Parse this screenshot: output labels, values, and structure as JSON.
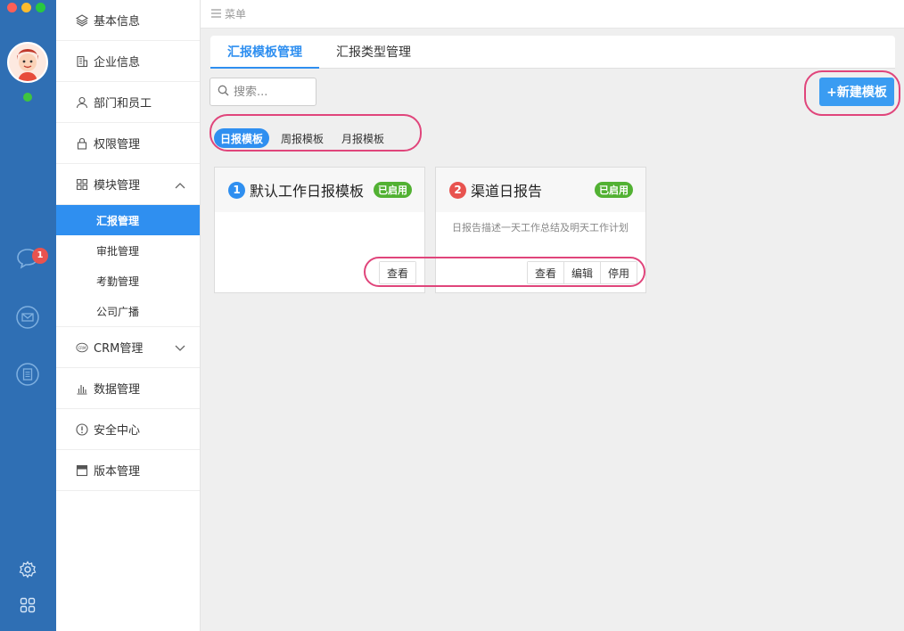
{
  "menu_bar": {
    "label": "菜单"
  },
  "sidebar": {
    "items": [
      {
        "label": "基本信息",
        "icon": "layers-icon"
      },
      {
        "label": "企业信息",
        "icon": "building-icon"
      },
      {
        "label": "部门和员工",
        "icon": "user-icon"
      },
      {
        "label": "权限管理",
        "icon": "lock-icon"
      },
      {
        "label": "模块管理",
        "icon": "grid-icon",
        "expanded": true,
        "children": [
          {
            "label": "汇报管理",
            "active": true
          },
          {
            "label": "审批管理"
          },
          {
            "label": "考勤管理"
          },
          {
            "label": "公司广播"
          }
        ]
      },
      {
        "label": "CRM管理",
        "icon": "crm-icon"
      },
      {
        "label": "数据管理",
        "icon": "bar-chart-icon"
      },
      {
        "label": "安全中心",
        "icon": "alert-icon"
      },
      {
        "label": "版本管理",
        "icon": "card-icon"
      }
    ]
  },
  "rail": {
    "chat_badge": "1"
  },
  "tabs": [
    {
      "label": "汇报模板管理",
      "active": true
    },
    {
      "label": "汇报类型管理",
      "active": false
    }
  ],
  "search": {
    "placeholder": "搜索..."
  },
  "new_button": {
    "label": "+新建模板"
  },
  "subtabs": [
    {
      "label": "日报模板",
      "active": true
    },
    {
      "label": "周报模板",
      "active": false
    },
    {
      "label": "月报模板",
      "active": false
    }
  ],
  "cards": [
    {
      "number": "1",
      "number_color": "#2f8ff0",
      "title": "默认工作日报模板",
      "status": "已启用",
      "description": "",
      "actions": [
        "查看"
      ]
    },
    {
      "number": "2",
      "number_color": "#e8534f",
      "title": "渠道日报告",
      "status": "已启用",
      "description": "日报告描述一天工作总结及明天工作计划",
      "actions": [
        "查看",
        "编辑",
        "停用"
      ]
    }
  ],
  "colors": {
    "accent": "#2f8ff0",
    "rail": "#2f6fb4",
    "status_green": "#52b133",
    "highlight_ring": "#e0457b"
  }
}
